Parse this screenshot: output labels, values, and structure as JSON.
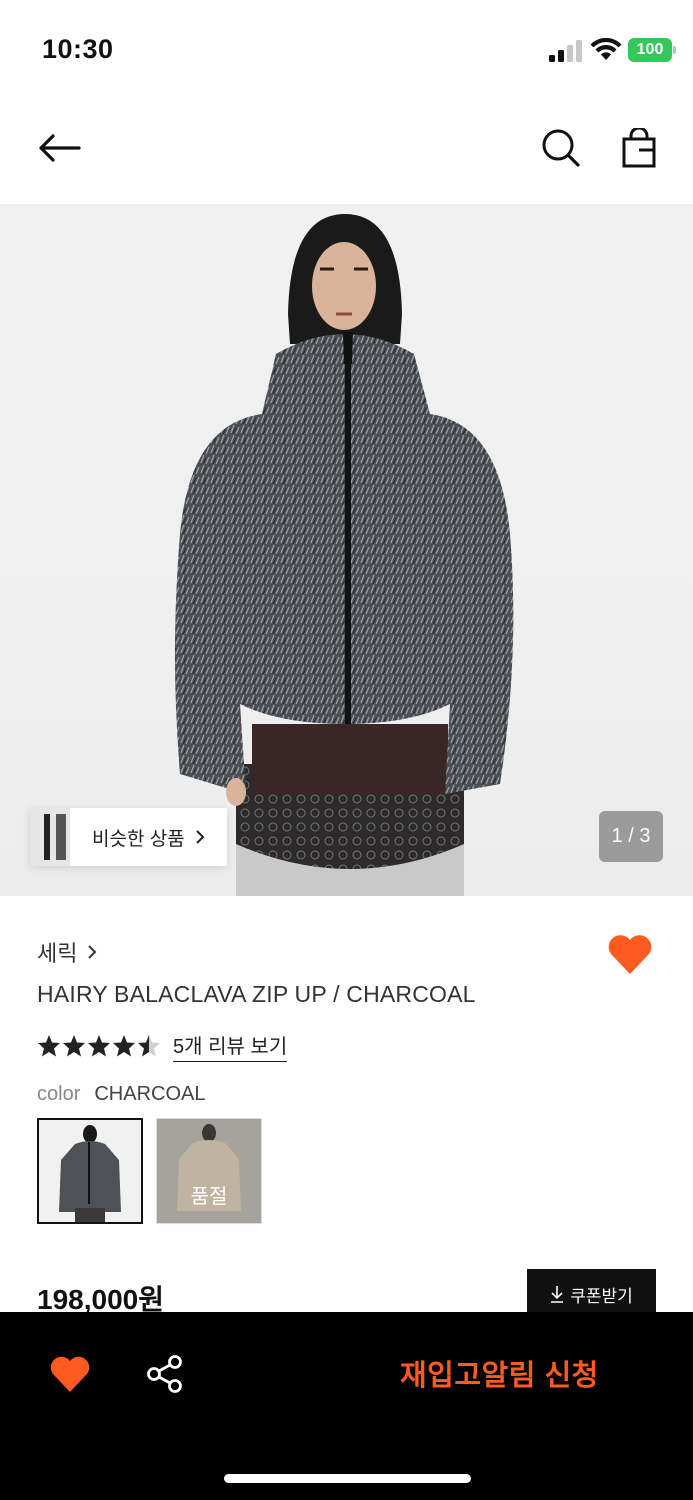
{
  "status_bar": {
    "time": "10:30",
    "battery": "100"
  },
  "nav": {
    "back_icon": "arrow-left-icon",
    "search_icon": "search-icon",
    "bag_icon": "shopping-bag-icon"
  },
  "hero": {
    "similar_label": "비슷한 상품",
    "counter": "1 / 3"
  },
  "product": {
    "brand": "세릭",
    "title": "HAIRY BALACLAVA ZIP UP / CHARCOAL",
    "rating": 4.5,
    "reviews_link": "5개 리뷰 보기",
    "color_label": "color",
    "color_value": "CHARCOAL",
    "swatches": [
      {
        "name": "CHARCOAL",
        "selected": true
      },
      {
        "name": "BEIGE",
        "soldout_label": "품절"
      }
    ],
    "price": "198,000원",
    "coupon_label": "쿠폰받기"
  },
  "bottom_bar": {
    "restock_label": "재입고알림 신청"
  },
  "colors": {
    "accent": "#ff5a1f",
    "dark": "#000000",
    "battery": "#34c759"
  }
}
